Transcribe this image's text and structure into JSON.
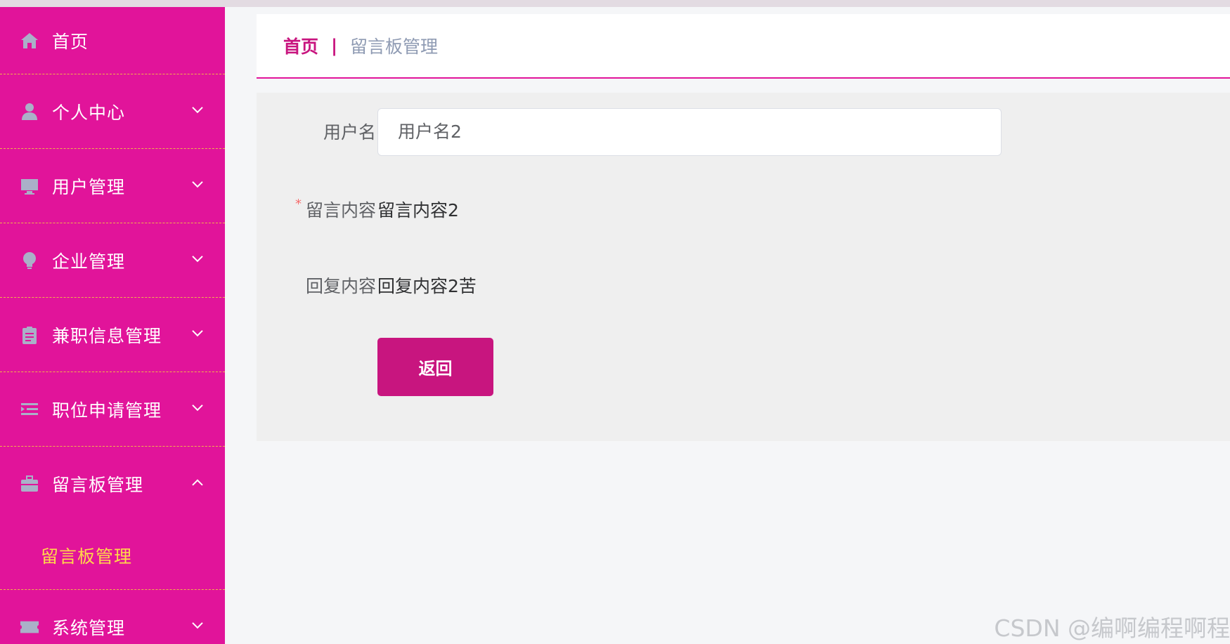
{
  "sidebar": {
    "items": [
      {
        "label": "首页",
        "icon": "home-icon",
        "expandable": false
      },
      {
        "label": "个人中心",
        "icon": "user-icon",
        "expandable": true
      },
      {
        "label": "用户管理",
        "icon": "monitor-icon",
        "expandable": true
      },
      {
        "label": "企业管理",
        "icon": "bulb-icon",
        "expandable": true
      },
      {
        "label": "兼职信息管理",
        "icon": "clipboard-icon",
        "expandable": true
      },
      {
        "label": "职位申请管理",
        "icon": "list-icon",
        "expandable": true
      },
      {
        "label": "留言板管理",
        "icon": "briefcase-icon",
        "expandable": true,
        "open": true
      },
      {
        "label": "系统管理",
        "icon": "ticket-icon",
        "expandable": true
      }
    ],
    "sub_item": {
      "label": "留言板管理"
    },
    "colors": {
      "background": "#e1149a",
      "active_sub": "#ffd84a",
      "icon": "#aab0c8",
      "divider": "#f0b44a"
    }
  },
  "breadcrumb": {
    "home": "首页",
    "separator": "|",
    "current": "留言板管理"
  },
  "form": {
    "username": {
      "label": "用户名",
      "value": "用户名2"
    },
    "message": {
      "label": "留言内容",
      "required_mark": "*",
      "value": "留言内容2"
    },
    "reply": {
      "label": "回复内容",
      "value": "回复内容2苦"
    },
    "back_button": "返回"
  },
  "watermark": "CSDN @编啊编程啊程",
  "colors": {
    "accent": "#c8157f",
    "breadcrumb_muted": "#8f9bb3"
  }
}
